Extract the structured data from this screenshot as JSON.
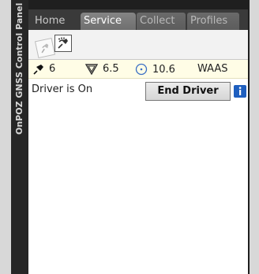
{
  "window": {
    "panel_title": "OnPOZ GNSS Control Panel"
  },
  "tabs": [
    {
      "label": "Home"
    },
    {
      "label": "Service"
    },
    {
      "label": "Collect"
    },
    {
      "label": "Profiles"
    }
  ],
  "active_tab": "Service",
  "subtabs": [
    {
      "icon": "satellite-signal-icon"
    },
    {
      "icon": "satellite-signal-icon"
    }
  ],
  "status": {
    "satellites": "6",
    "pdop": "6.5",
    "accuracy": "10.6",
    "correction": "WAAS"
  },
  "driver": {
    "status_text": "Driver is On",
    "end_button_label": "End Driver",
    "info_icon": "info-icon"
  },
  "colors": {
    "status_bg": "#fffde6",
    "info_blue": "#1f5fbf",
    "frame_dark": "#1f1f1f"
  }
}
